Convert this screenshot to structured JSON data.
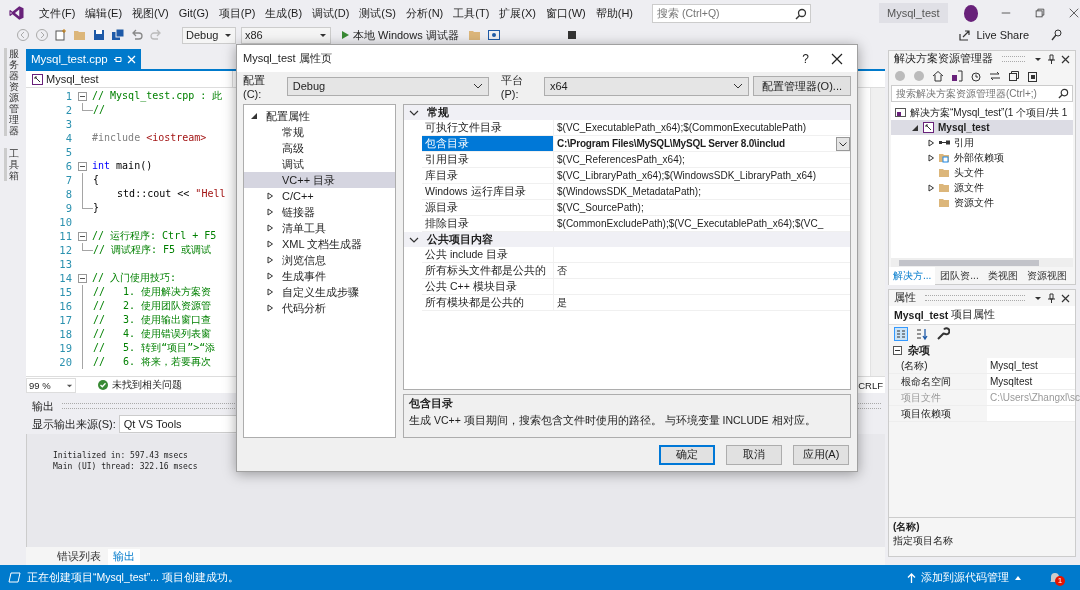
{
  "title_bar": {
    "menus": [
      "文件(F)",
      "编辑(E)",
      "视图(V)",
      "Git(G)",
      "项目(P)",
      "生成(B)",
      "调试(D)",
      "测试(S)",
      "分析(N)",
      "工具(T)",
      "扩展(X)",
      "窗口(W)",
      "帮助(H)"
    ],
    "search": {
      "placeholder": "搜索 (Ctrl+Q)"
    },
    "solution_name": "Mysql_test"
  },
  "toolbar": {
    "configuration": "Debug",
    "platform": "x86",
    "run_label": "本地 Windows 调试器",
    "live_share": "Live Share"
  },
  "side_tabs": [
    "服务器资源管理器",
    "工具箱"
  ],
  "editor": {
    "tabs": [
      {
        "label": "Mysql_test.cpp",
        "selected": true
      }
    ],
    "scope": "Mysql_test",
    "lines": [
      {
        "number": "1",
        "collapsible": true,
        "in_block": false,
        "tokens": [
          {
            "kind": "comment",
            "text": "// Mysql_test.cpp : 此"
          }
        ]
      },
      {
        "number": "2",
        "collapsible": false,
        "in_block": true,
        "tokens": [
          {
            "kind": "comment",
            "text": "//"
          }
        ]
      },
      {
        "number": "3",
        "collapsible": false,
        "in_block": false
      },
      {
        "number": "4",
        "collapsible": false,
        "in_block": false,
        "tokens": [
          {
            "kind": "preproc",
            "text": "#include "
          },
          {
            "kind": "string",
            "text": "<iostream>"
          }
        ]
      },
      {
        "number": "5",
        "collapsible": false,
        "in_block": false
      },
      {
        "number": "6",
        "collapsible": true,
        "in_block": false,
        "tokens": [
          {
            "kind": "keyword",
            "text": "int"
          },
          {
            "kind": "plain",
            "text": " main()"
          }
        ]
      },
      {
        "number": "7",
        "collapsible": false,
        "in_block": true,
        "tokens": [
          {
            "kind": "plain",
            "text": "{"
          }
        ]
      },
      {
        "number": "8",
        "collapsible": false,
        "in_block": true,
        "tokens": [
          {
            "kind": "plain",
            "text": "    std::cout << "
          },
          {
            "kind": "string",
            "text": "\"Hell"
          }
        ]
      },
      {
        "number": "9",
        "collapsible": false,
        "in_block": true,
        "tokens": [
          {
            "kind": "plain",
            "text": "}"
          }
        ]
      },
      {
        "number": "10",
        "collapsible": false,
        "in_block": false
      },
      {
        "number": "11",
        "collapsible": true,
        "in_block": false,
        "tokens": [
          {
            "kind": "comment",
            "text": "// 运行程序: Ctrl + F5"
          }
        ]
      },
      {
        "number": "12",
        "collapsible": false,
        "in_block": true,
        "tokens": [
          {
            "kind": "comment",
            "text": "// 调试程序: F5 或调试"
          }
        ]
      },
      {
        "number": "13",
        "collapsible": false,
        "in_block": false
      },
      {
        "number": "14",
        "collapsible": true,
        "in_block": false,
        "tokens": [
          {
            "kind": "comment",
            "text": "// 入门使用技巧: "
          }
        ]
      },
      {
        "number": "15",
        "collapsible": false,
        "in_block": true,
        "tokens": [
          {
            "kind": "comment",
            "text": "//   1. 使用解决方案资"
          }
        ]
      },
      {
        "number": "16",
        "collapsible": false,
        "in_block": true,
        "tokens": [
          {
            "kind": "comment",
            "text": "//   2. 使用团队资源管"
          }
        ]
      },
      {
        "number": "17",
        "collapsible": false,
        "in_block": true,
        "tokens": [
          {
            "kind": "comment",
            "text": "//   3. 使用输出窗口查"
          }
        ]
      },
      {
        "number": "18",
        "collapsible": false,
        "in_block": true,
        "tokens": [
          {
            "kind": "comment",
            "text": "//   4. 使用错误列表窗"
          }
        ]
      },
      {
        "number": "19",
        "collapsible": false,
        "in_block": true,
        "tokens": [
          {
            "kind": "comment",
            "text": "//   5. 转到“项目”>“添"
          }
        ]
      },
      {
        "number": "20",
        "collapsible": false,
        "in_block": true,
        "tokens": [
          {
            "kind": "comment",
            "text": "//   6. 将来，若要再次"
          }
        ]
      }
    ],
    "zoom": "99 %",
    "issues": "未找到相关问题",
    "line_ending": "CRLF"
  },
  "output": {
    "title": "输出",
    "source_label": "显示输出来源(S):",
    "source": "Qt VS Tools",
    "lines": [
      "Initialized in: 597.43 msecs",
      "Main (UI) thread: 322.16 msecs"
    ],
    "tabs": [
      {
        "label": "错误列表",
        "selected": false
      },
      {
        "label": "输出",
        "selected": true
      }
    ]
  },
  "dialog": {
    "title": "Mysql_test 属性页",
    "help": "?",
    "config_label": "配置(C):",
    "config": "Debug",
    "platform_label": "平台(P):",
    "platform": "x64",
    "manager_button": "配置管理器(O)...",
    "tree": [
      {
        "label": "配置属性",
        "selected": false,
        "expanded": true,
        "children": [
          {
            "label": "常规",
            "selected": false
          },
          {
            "label": "高级",
            "selected": false
          },
          {
            "label": "调试",
            "selected": false
          },
          {
            "label": "VC++ 目录",
            "selected": true
          },
          {
            "label": "C/C++",
            "selected": false,
            "expanded": false
          },
          {
            "label": "链接器",
            "selected": false,
            "expanded": false
          },
          {
            "label": "清单工具",
            "selected": false,
            "expanded": false
          },
          {
            "label": "XML 文档生成器",
            "selected": false,
            "expanded": false
          },
          {
            "label": "浏览信息",
            "selected": false,
            "expanded": false
          },
          {
            "label": "生成事件",
            "selected": false,
            "expanded": false
          },
          {
            "label": "自定义生成步骤",
            "selected": false,
            "expanded": false
          },
          {
            "label": "代码分析",
            "selected": false,
            "expanded": false
          }
        ]
      }
    ],
    "sections": [
      {
        "title": "常规",
        "expanded": true,
        "rows": [
          {
            "name": "可执行文件目录",
            "value": "$(VC_ExecutablePath_x64);$(CommonExecutablePath)",
            "selected": false,
            "modified": false
          },
          {
            "name": "包含目录",
            "value": "C:\\Program Files\\MySQL\\MySQL Server 8.0\\includ",
            "selected": true,
            "modified": true
          },
          {
            "name": "引用目录",
            "value": "$(VC_ReferencesPath_x64);",
            "selected": false,
            "modified": false
          },
          {
            "name": "库目录",
            "value": "$(VC_LibraryPath_x64);$(WindowsSDK_LibraryPath_x64)",
            "selected": false,
            "modified": false
          },
          {
            "name": "Windows 运行库目录",
            "value": "$(WindowsSDK_MetadataPath);",
            "selected": false,
            "modified": false
          },
          {
            "name": "源目录",
            "value": "$(VC_SourcePath);",
            "selected": false,
            "modified": false
          },
          {
            "name": "排除目录",
            "value": "$(CommonExcludePath);$(VC_ExecutablePath_x64);$(VC_",
            "selected": false,
            "modified": false
          }
        ]
      },
      {
        "title": "公共项目内容",
        "expanded": true,
        "rows": [
          {
            "name": "公共 include 目录",
            "selected": false
          },
          {
            "name": "所有标头文件都是公共的",
            "value": "否",
            "selected": false,
            "modified": false
          },
          {
            "name": "公共 C++ 模块目录",
            "selected": false
          },
          {
            "name": "所有模块都是公共的",
            "value": "是",
            "selected": false,
            "modified": false
          }
        ]
      }
    ],
    "description": {
      "title": "包含目录",
      "text": "生成 VC++ 项目期间，搜索包含文件时使用的路径。 与环境变量 INCLUDE 相对应。"
    },
    "buttons": [
      {
        "label": "确定",
        "default": true
      },
      {
        "label": "取消",
        "default": false
      },
      {
        "label": "应用(A)",
        "default": false
      }
    ]
  },
  "solution_explorer": {
    "title": "解决方案资源管理器",
    "search": {
      "placeholder": "搜索解决方案资源管理器(Ctrl+;)"
    },
    "tree": [
      {
        "label": "解决方案“Mysql_test”(1 个项目/共 1",
        "kind": "solution",
        "selected": false,
        "children": [
          {
            "label": "Mysql_test",
            "kind": "project",
            "selected": true,
            "expanded": true,
            "children": [
              {
                "label": "引用",
                "kind": "references",
                "selected": false,
                "expanded": false
              },
              {
                "label": "外部依赖项",
                "kind": "external",
                "selected": false,
                "expanded": false
              },
              {
                "label": "头文件",
                "kind": "folder",
                "selected": false
              },
              {
                "label": "源文件",
                "kind": "folder",
                "selected": false,
                "expanded": false
              },
              {
                "label": "资源文件",
                "kind": "folder",
                "selected": false
              }
            ]
          }
        ]
      }
    ],
    "tabs": [
      {
        "label": "解决方...",
        "selected": true
      },
      {
        "label": "团队资...",
        "selected": false
      },
      {
        "label": "类视图",
        "selected": false
      },
      {
        "label": "资源视图",
        "selected": false
      }
    ]
  },
  "properties": {
    "title": "属性",
    "object": "Mysql_test",
    "object_type": "项目属性",
    "category": "杂项",
    "rows": [
      {
        "name": "(名称)",
        "value": "Mysql_test",
        "disabled": false
      },
      {
        "name": "根命名空间",
        "value": "Mysqltest",
        "disabled": false
      },
      {
        "name": "项目文件",
        "value": "C:\\Users\\Zhangxl\\sc",
        "disabled": true
      },
      {
        "name": "项目依赖项",
        "disabled": false
      }
    ],
    "description": {
      "title": "(名称)",
      "text": "指定项目名称"
    }
  },
  "status_bar": {
    "message": "正在创建项目“Mysql_test”... 项目创建成功。",
    "source_control": "添加到源代码管理",
    "notifications": "1"
  }
}
